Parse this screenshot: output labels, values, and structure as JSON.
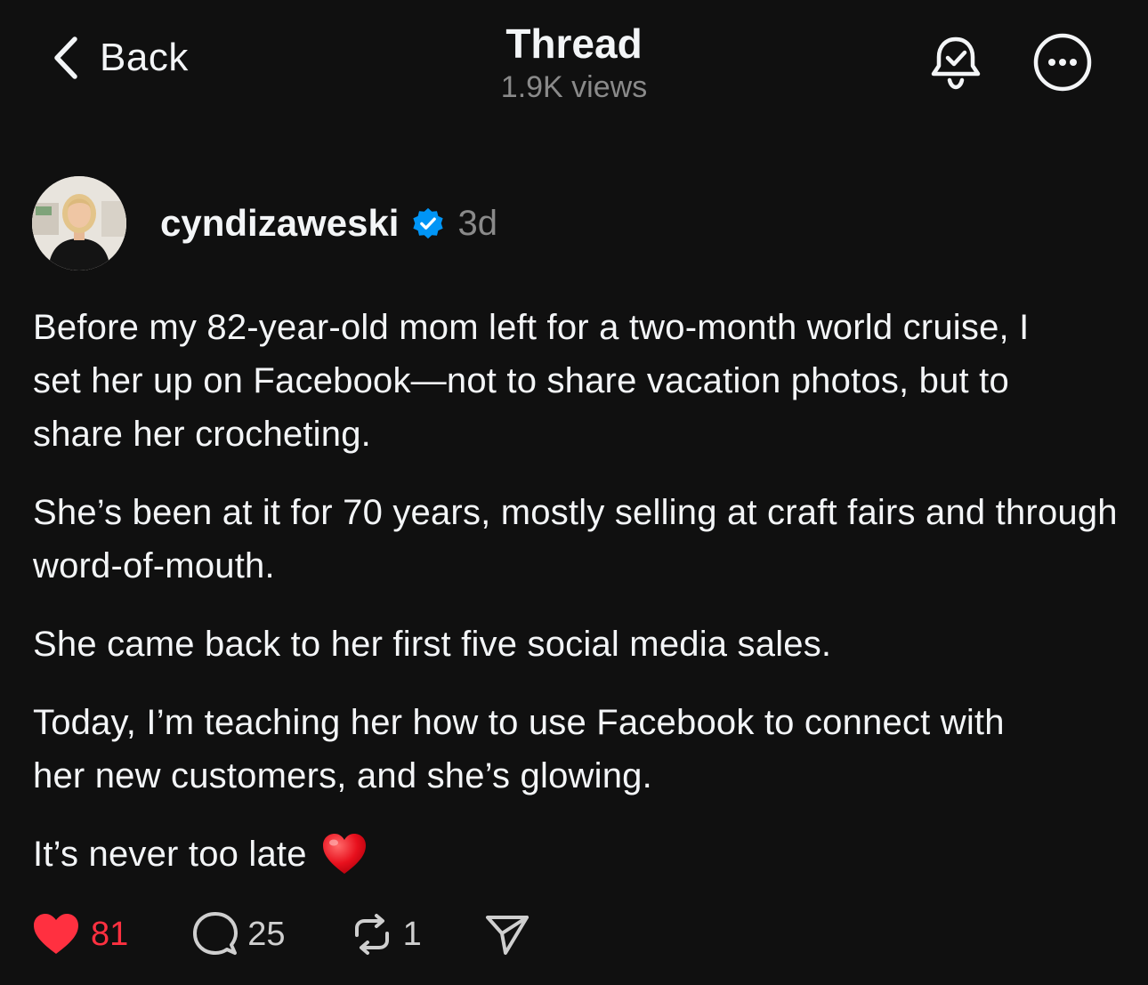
{
  "header": {
    "back_label": "Back",
    "title": "Thread",
    "subtitle": "1.9K views"
  },
  "post": {
    "author": "cyndizaweski",
    "verified": true,
    "timestamp": "3d",
    "paragraphs": [
      "Before my 82-year-old mom left for a two-month world cruise, I set her up on Facebook—not to share vacation photos, but to share her crocheting.",
      "She’s been at it for 70 years, mostly selling at craft fairs and through word-of-mouth.",
      "She came back to her first five social media sales.",
      "Today, I’m teaching her how to use Facebook to connect with her new customers, and she’s glowing."
    ],
    "closing": "It’s never too late",
    "closing_emoji": "red-heart"
  },
  "actions": {
    "likes": "81",
    "replies": "25",
    "reposts": "1",
    "liked": true
  },
  "colors": {
    "background": "#101010",
    "text": "#f3f5f7",
    "secondary": "#8a8a8a",
    "like": "#ff3040",
    "verified": "#0095f6"
  },
  "icons": {
    "back": "chevron-left-icon",
    "bell": "bell-check-icon",
    "more": "more-circle-icon",
    "verified": "verified-badge-icon",
    "like": "heart-icon",
    "reply": "comment-bubble-icon",
    "repost": "repost-icon",
    "share": "send-icon"
  }
}
